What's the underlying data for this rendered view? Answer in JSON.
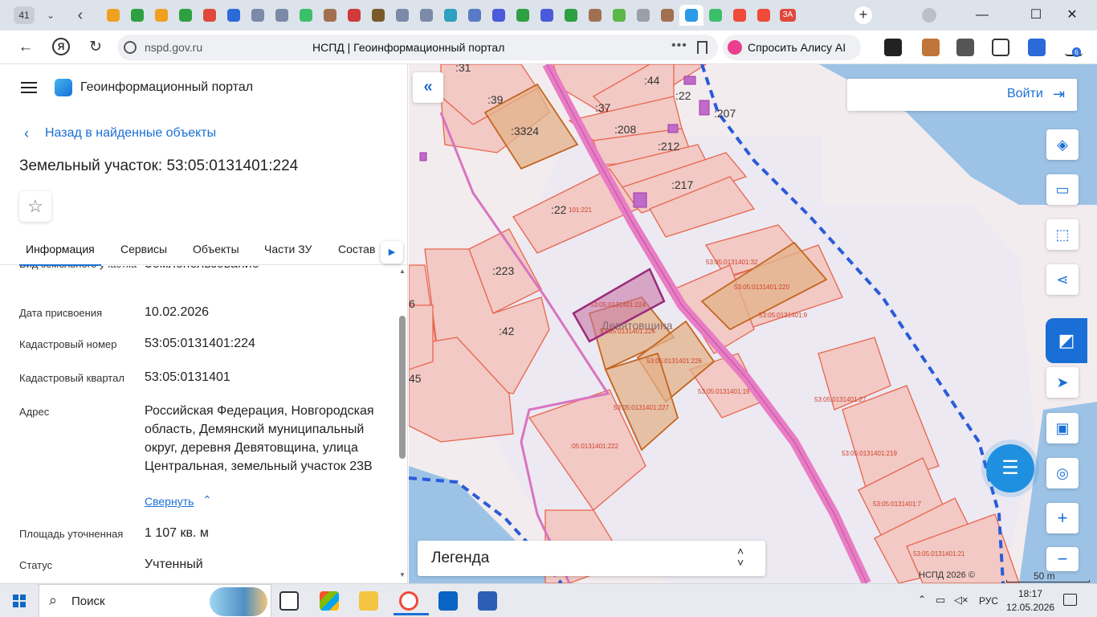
{
  "browser": {
    "tab_count": "41",
    "dropdown_icon": "chevron-down-icon",
    "url": "nspd.gov.ru",
    "page_title": "НСПД | Геоинформационный портал",
    "alice_label": "Спросить Алису AI",
    "extension_badge": "6",
    "pinned_tabs": [
      {
        "icon": "mail-icon",
        "color": "#f0a020"
      },
      {
        "icon": "sheet-icon",
        "color": "#2ea043"
      },
      {
        "icon": "mail-icon",
        "color": "#f0a020"
      },
      {
        "icon": "sheet-icon",
        "color": "#2ea043"
      },
      {
        "icon": "pdf-icon",
        "color": "#e0483c"
      },
      {
        "icon": "mail-icon",
        "color": "#2b6ad8"
      },
      {
        "icon": "emblem-icon",
        "color": "#7a8aa8"
      },
      {
        "icon": "emblem-icon",
        "color": "#7a8aa8"
      },
      {
        "icon": "map-icon",
        "color": "#3bbf6a"
      },
      {
        "icon": "avatar-icon",
        "color": "#a07050"
      },
      {
        "icon": "flag-icon",
        "color": "#d03a3a"
      },
      {
        "icon": "emblem-icon",
        "color": "#7a5a2a"
      },
      {
        "icon": "emblem-icon",
        "color": "#7a8aa8"
      },
      {
        "icon": "emblem-icon",
        "color": "#7a8aa8"
      },
      {
        "icon": "shield-icon",
        "color": "#2ea0c0"
      },
      {
        "icon": "emblem-icon",
        "color": "#5a7ac8"
      },
      {
        "icon": "circle-icon",
        "color": "#4a5ad8"
      },
      {
        "icon": "sheet-icon",
        "color": "#2ea043"
      },
      {
        "icon": "circle-icon",
        "color": "#4a5ad8"
      },
      {
        "icon": "sheet-icon",
        "color": "#2ea043"
      },
      {
        "icon": "avatar-icon",
        "color": "#a07050"
      },
      {
        "icon": "check-icon",
        "color": "#5ab84a"
      },
      {
        "icon": "doc-icon",
        "color": "#9aa0a8"
      },
      {
        "icon": "avatar-icon",
        "color": "#a07050"
      },
      {
        "icon": "portal-icon",
        "color": "#2b9ae8"
      },
      {
        "icon": "map-icon",
        "color": "#3bbf6a"
      },
      {
        "icon": "yandex-icon",
        "color": "#f04a3a"
      },
      {
        "icon": "yandex-icon",
        "color": "#f04a3a"
      },
      {
        "icon": "text-icon",
        "color": "#e0483c",
        "text": "ЗА"
      }
    ]
  },
  "panel": {
    "app_title": "Геоинформационный портал",
    "back_link": "Назад в найденные объекты",
    "object_title": "Земельный участок: 53:05:0131401:224",
    "tabs": [
      "Информация",
      "Сервисы",
      "Объекты",
      "Части ЗУ",
      "Состав"
    ],
    "attributes": [
      {
        "label": "Вид земельного участка",
        "value": "Землепользование"
      },
      {
        "label": "Дата присвоения",
        "value": "10.02.2026"
      },
      {
        "label": "Кадастровый номер",
        "value": "53:05:0131401:224"
      },
      {
        "label": "Кадастровый квартал",
        "value": "53:05:0131401"
      },
      {
        "label": "Адрес",
        "value": "Российская Федерация, Новгородская область, Демянский муниципальный округ, деревня Девятовщина, улица Центральная, земельный участок 23В"
      },
      {
        "label": "Площадь уточненная",
        "value": "1 107 кв. м"
      },
      {
        "label": "Статус",
        "value": "Учтенный"
      }
    ],
    "collapse_label": "Свернуть"
  },
  "map": {
    "login_label": "Войти",
    "legend_label": "Легенда",
    "copyright": "НСПД 2026 ©",
    "scale_label": "50 m",
    "place_name": "Девятовщина",
    "parcel_labels": [
      ":31",
      ":39",
      ":3324",
      ":44",
      ":22",
      ":37",
      ":207",
      ":208",
      ":212",
      ":217",
      ":22",
      ":223",
      ":42",
      "6",
      "45"
    ],
    "small_labels": [
      "101:221",
      "53:05:0131401:32",
      "53:05:0131401:220",
      "53:05:0131401:9",
      "53:05:0131401:224",
      "53:05:0131401:225",
      "53:05:0131401:226",
      "53:05:0131401:19",
      "53:05:0131401:227",
      ":05:0131401:222",
      "53:05:0131401:27",
      "53:05:0131401:219",
      "53:05:0131401:7",
      "53:05:0131401:21"
    ],
    "tools": [
      "layers-icon",
      "ruler-icon",
      "select-area-icon",
      "share-icon",
      "highlight-object-icon",
      "navigate-icon",
      "print-icon",
      "geolocation-icon",
      "zoom-in-icon",
      "zoom-out-icon"
    ],
    "colors": {
      "water": "#9cc3e6",
      "road": "#e97cc4",
      "parcel_fill": "#f2c9c4",
      "parcel_stroke": "#e8654f",
      "selected": "#9b2a7a",
      "boundary": "#2a5bd8",
      "accent": "#1a6fd6"
    }
  },
  "taskbar": {
    "search_label": "Поиск",
    "language": "РУС",
    "time": "18:17",
    "date": "12.05.2026",
    "apps": [
      "task-view-icon",
      "store-icon",
      "folder-icon",
      "yandex-browser-icon",
      "outlook-icon",
      "word-icon"
    ]
  }
}
